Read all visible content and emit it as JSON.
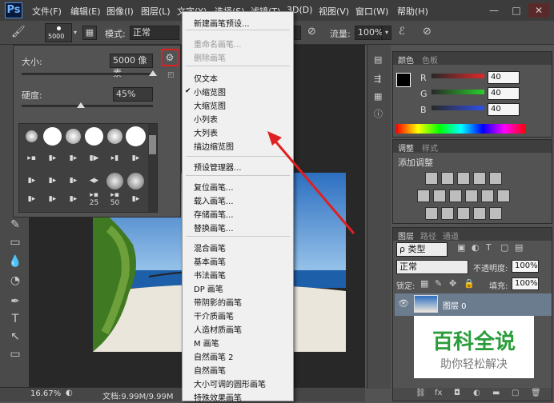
{
  "menubar": {
    "logo": "Ps",
    "items": [
      "文件(F)",
      "编辑(E)",
      "图像(I)",
      "图层(L)",
      "文字(Y)",
      "选择(S)",
      "滤镜(T)",
      "3D(D)",
      "视图(V)",
      "窗口(W)",
      "帮助(H)"
    ],
    "window_buttons": [
      "—",
      "□",
      "✕"
    ]
  },
  "options": {
    "brush_size": "5000",
    "mode_label": "模式:",
    "mode_value": "正常",
    "flow_label": "流量:",
    "flow_value": "100%"
  },
  "brush_panel": {
    "size_label": "大小:",
    "size_value": "5000 像素",
    "hardness_label": "硬度:",
    "hardness_value": "45%",
    "size_level": 1.0,
    "hardness_level": 0.45,
    "sample_numbers": [
      "25",
      "50"
    ]
  },
  "context_menu": {
    "items": [
      {
        "label": "新建画笔预设...",
        "disabled": false
      },
      {
        "label": "重命名画笔...",
        "disabled": true
      },
      {
        "label": "删除画笔",
        "disabled": true
      },
      {
        "label": "仅文本",
        "disabled": false
      },
      {
        "label": "小缩览图",
        "disabled": false,
        "checked": true
      },
      {
        "label": "大缩览图",
        "disabled": false
      },
      {
        "label": "小列表",
        "disabled": false
      },
      {
        "label": "大列表",
        "disabled": false
      },
      {
        "label": "描边缩览图",
        "disabled": false
      },
      {
        "label": "预设管理器...",
        "disabled": false
      },
      {
        "label": "复位画笔...",
        "disabled": false
      },
      {
        "label": "载入画笔...",
        "disabled": false
      },
      {
        "label": "存储画笔...",
        "disabled": false
      },
      {
        "label": "替换画笔...",
        "disabled": false
      },
      {
        "label": "混合画笔",
        "disabled": false
      },
      {
        "label": "基本画笔",
        "disabled": false
      },
      {
        "label": "书法画笔",
        "disabled": false
      },
      {
        "label": "DP 画笔",
        "disabled": false
      },
      {
        "label": "带阴影的画笔",
        "disabled": false
      },
      {
        "label": "干介质画笔",
        "disabled": false
      },
      {
        "label": "人造材质画笔",
        "disabled": false
      },
      {
        "label": "M 画笔",
        "disabled": false
      },
      {
        "label": "自然画笔 2",
        "disabled": false
      },
      {
        "label": "自然画笔",
        "disabled": false
      },
      {
        "label": "大小可调的圆形画笔",
        "disabled": false
      },
      {
        "label": "特殊效果画笔",
        "disabled": false
      }
    ],
    "checkmark": "✔"
  },
  "color_panel": {
    "tabs": [
      "颜色",
      "色板"
    ],
    "channels": [
      {
        "label": "R",
        "value": "40",
        "color": "#e04040"
      },
      {
        "label": "G",
        "value": "40",
        "color": "#40c040"
      },
      {
        "label": "B",
        "value": "40",
        "color": "#4060e0"
      }
    ]
  },
  "adjust_panel": {
    "tabs": [
      "调整",
      "样式"
    ],
    "title": "添加调整"
  },
  "layers_panel": {
    "tabs": [
      "图层",
      "路径",
      "通道"
    ],
    "filter_label": "ρ 类型",
    "blend_mode": "正常",
    "opacity_label": "不透明度:",
    "opacity_value": "100%",
    "lock_label": "锁定:",
    "fill_label": "填充:",
    "fill_value": "100%",
    "layer_name": "图层 0"
  },
  "statusbar": {
    "zoom": "16.67%",
    "doc": "文档:9.99M/9.99M"
  },
  "watermark": {
    "title": "百科全说",
    "subtitle": "助你轻松解决"
  }
}
